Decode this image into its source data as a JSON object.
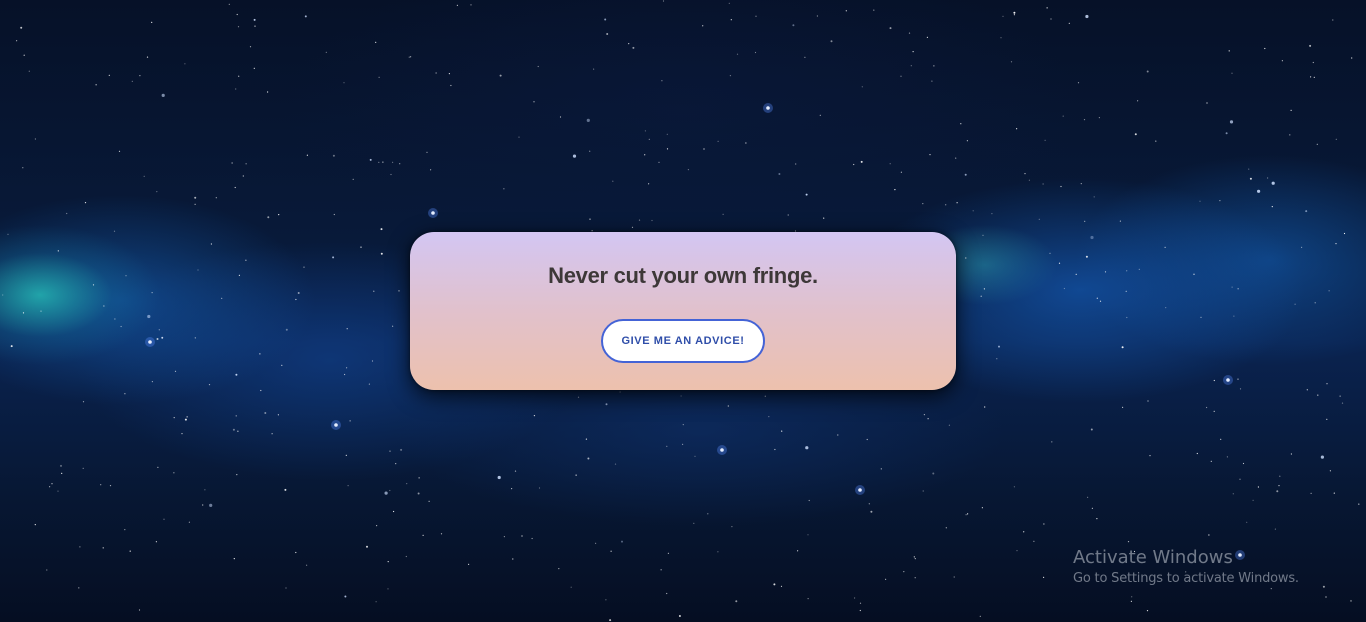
{
  "background": {
    "description_icon": "starfield-background",
    "colors": {
      "deep_space": "#050d1f",
      "nebula_blue": "#0a2350",
      "nebula_teal": "#28c8be"
    }
  },
  "card": {
    "advice": "Never cut your own fringe.",
    "button_label": "GIVE ME AN ADVICE!",
    "colors": {
      "gradient_top": "#d3c6f3",
      "gradient_bottom": "#edc1ad",
      "text": "#3d3838",
      "button_border": "#4463d6",
      "button_text": "#2f4ea9"
    }
  },
  "watermark": {
    "title": "Activate Windows",
    "subtitle": "Go to Settings to activate Windows."
  }
}
